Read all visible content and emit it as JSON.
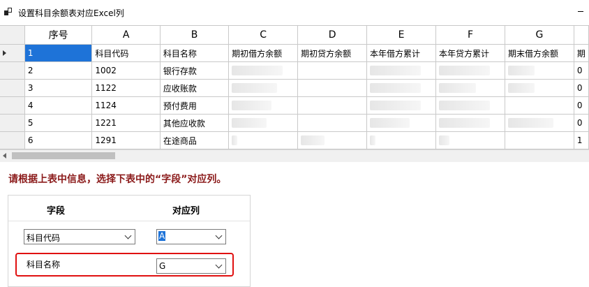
{
  "window": {
    "title": "设置科目余额表对应Excel列",
    "icon": "app-window-icon"
  },
  "grid": {
    "columns": [
      "序号",
      "A",
      "B",
      "C",
      "D",
      "E",
      "F",
      "G",
      ""
    ],
    "rows": [
      [
        "1",
        "科目代码",
        "科目名称",
        "期初借方余额",
        "期初贷方余额",
        "本年借方累计",
        "本年贷方累计",
        "期末借方余额",
        "期"
      ],
      [
        "2",
        "1002",
        "银行存款",
        "0100109.07",
        "",
        "1089000.00",
        "0000000.00",
        "82897",
        "0"
      ],
      [
        "3",
        "1122",
        "应收账款",
        "200000.42",
        "",
        "0000400.75",
        "0  157.00",
        "28397",
        "0"
      ],
      [
        "4",
        "1124",
        "预付费用",
        "10000.00",
        "",
        "0100007.40",
        "0000000.00",
        "",
        "0"
      ],
      [
        "5",
        "1221",
        "其他应收款",
        "1.10125",
        "",
        "10000.00",
        "0100072.59",
        "293494.01",
        "0"
      ],
      [
        "6",
        "1291",
        "在途商品",
        "0",
        "33.00",
        "0",
        "00",
        "",
        "1"
      ]
    ],
    "obscured_cells": [
      [
        1,
        3
      ],
      [
        1,
        5
      ],
      [
        1,
        6
      ],
      [
        1,
        7
      ],
      [
        2,
        3
      ],
      [
        2,
        5
      ],
      [
        2,
        6
      ],
      [
        2,
        7
      ],
      [
        3,
        3
      ],
      [
        3,
        5
      ],
      [
        3,
        6
      ],
      [
        4,
        3
      ],
      [
        4,
        5
      ],
      [
        4,
        6
      ],
      [
        4,
        7
      ],
      [
        5,
        3
      ],
      [
        5,
        4
      ],
      [
        5,
        5
      ],
      [
        5,
        6
      ]
    ]
  },
  "prompt": "请根据上表中信息，选择下表中的“字段”对应列。",
  "mapping": {
    "header_field": "字段",
    "header_column": "对应列",
    "rows": [
      {
        "field": "科目代码",
        "column": "A"
      },
      {
        "field": "科目名称",
        "column": "G"
      }
    ]
  },
  "colors": {
    "selection": "#1e73d8",
    "prompt": "#8b1a1a",
    "highlight_box": "#e01010"
  }
}
